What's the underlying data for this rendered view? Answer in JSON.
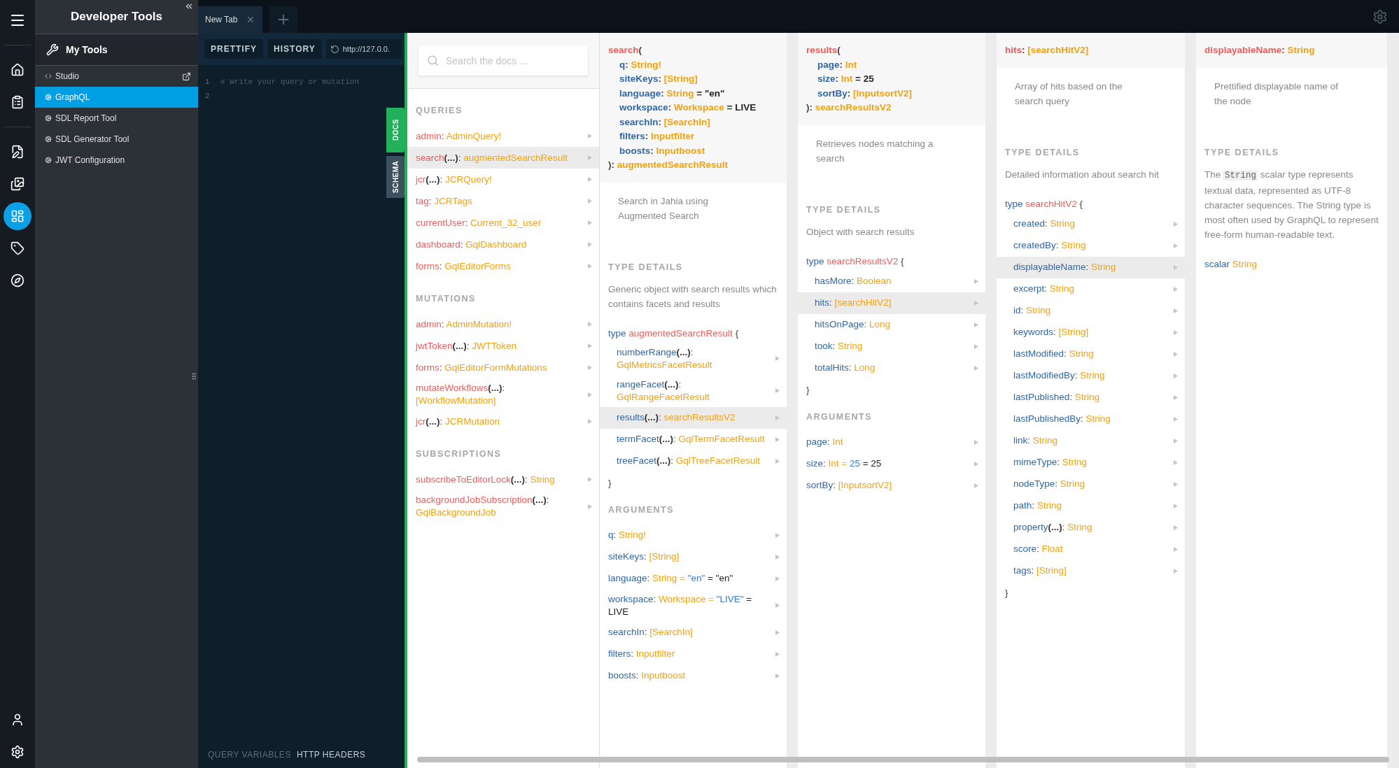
{
  "rail": {
    "top_items": [
      {
        "selected": false
      },
      {
        "selected": false
      },
      {
        "selected": false
      },
      {
        "selected": false
      },
      {
        "selected": true
      },
      {
        "selected": false
      },
      {
        "selected": false
      }
    ],
    "bottom_items": [
      {
        "selected": false
      },
      {
        "selected": false
      }
    ]
  },
  "sidebar": {
    "title": "Developer Tools",
    "section": "My Tools",
    "items": [
      {
        "label": "Studio",
        "selected": false,
        "external": true
      },
      {
        "label": "GraphQL",
        "selected": true,
        "external": false
      },
      {
        "label": "SDL Report Tool",
        "selected": false,
        "external": false
      },
      {
        "label": "SDL Generator Tool",
        "selected": false,
        "external": false
      },
      {
        "label": "JWT Configuration",
        "selected": false,
        "external": false
      }
    ]
  },
  "tabs": [
    {
      "label": "New Tab",
      "selected": true
    }
  ],
  "editor": {
    "buttons": [
      "PRETTIFY",
      "HISTORY"
    ],
    "url": "http://127.0.0.",
    "lines": [
      {
        "number": "1",
        "text": "# Write your query or mutation"
      },
      {
        "number": "2"
      }
    ],
    "panels": [
      {
        "label": "QUERY VARIABLES",
        "selected": false
      },
      {
        "label": "HTTP HEADERS",
        "selected": true
      }
    ],
    "side_tabs": [
      {
        "label": "DOCS",
        "selected": true
      },
      {
        "label": "SCHEMA",
        "selected": false
      }
    ]
  },
  "docs": {
    "search_placeholder": "Search the docs ...",
    "sections": [
      {
        "title": "QUERIES",
        "rows": [
          {
            "parts": [
              {
                "text": "admin",
                "kind": "root"
              },
              {
                "text": ": ",
                "kind": "punct"
              },
              {
                "text": "AdminQuery!",
                "kind": "type"
              }
            ],
            "selected": false
          },
          {
            "parts": [
              {
                "text": "search",
                "kind": "root"
              },
              {
                "text": "(...)",
                "kind": "args"
              },
              {
                "text": ": ",
                "kind": "punct"
              },
              {
                "text": "augmentedSearchResult",
                "kind": "type"
              }
            ],
            "selected": true
          },
          {
            "parts": [
              {
                "text": "jcr",
                "kind": "root"
              },
              {
                "text": "(...)",
                "kind": "args"
              },
              {
                "text": ": ",
                "kind": "punct"
              },
              {
                "text": "JCRQuery!",
                "kind": "type"
              }
            ],
            "selected": false
          },
          {
            "parts": [
              {
                "text": "tag",
                "kind": "root"
              },
              {
                "text": ": ",
                "kind": "punct"
              },
              {
                "text": "JCRTags",
                "kind": "type"
              }
            ],
            "selected": false
          },
          {
            "parts": [
              {
                "text": "currentUser",
                "kind": "root"
              },
              {
                "text": ": ",
                "kind": "punct"
              },
              {
                "text": "Current_32_user",
                "kind": "type"
              }
            ],
            "selected": false
          },
          {
            "parts": [
              {
                "text": "dashboard",
                "kind": "root"
              },
              {
                "text": ": ",
                "kind": "punct"
              },
              {
                "text": "GqlDashboard",
                "kind": "type"
              }
            ],
            "selected": false
          },
          {
            "parts": [
              {
                "text": "forms",
                "kind": "root"
              },
              {
                "text": ": ",
                "kind": "punct"
              },
              {
                "text": "GqlEditorForms",
                "kind": "type"
              }
            ],
            "selected": false
          }
        ]
      },
      {
        "title": "MUTATIONS",
        "rows": [
          {
            "parts": [
              {
                "text": "admin",
                "kind": "root"
              },
              {
                "text": ": ",
                "kind": "punct"
              },
              {
                "text": "AdminMutation!",
                "kind": "type"
              }
            ],
            "selected": false
          },
          {
            "parts": [
              {
                "text": "jwtToken",
                "kind": "root"
              },
              {
                "text": "(...)",
                "kind": "args"
              },
              {
                "text": ": ",
                "kind": "punct"
              },
              {
                "text": "JWTToken",
                "kind": "type"
              }
            ],
            "selected": false
          },
          {
            "parts": [
              {
                "text": "forms",
                "kind": "root"
              },
              {
                "text": ": ",
                "kind": "punct"
              },
              {
                "text": "GqlEditorFormMutations",
                "kind": "type"
              }
            ],
            "selected": false
          },
          {
            "parts": [
              {
                "text": "mutateWorkflows",
                "kind": "root"
              },
              {
                "text": "(...)",
                "kind": "args"
              },
              {
                "text": ": ",
                "kind": "punct"
              },
              {
                "text": "[WorkflowMutation]",
                "kind": "type"
              }
            ],
            "selected": false
          },
          {
            "parts": [
              {
                "text": "jcr",
                "kind": "root"
              },
              {
                "text": "(...)",
                "kind": "args"
              },
              {
                "text": ": ",
                "kind": "punct"
              },
              {
                "text": "JCRMutation",
                "kind": "type"
              }
            ],
            "selected": false
          }
        ]
      },
      {
        "title": "SUBSCRIPTIONS",
        "rows": [
          {
            "parts": [
              {
                "text": "subscribeToEditorLock",
                "kind": "root"
              },
              {
                "text": "(...)",
                "kind": "args"
              },
              {
                "text": ": ",
                "kind": "punct"
              },
              {
                "text": "String",
                "kind": "type"
              }
            ],
            "selected": false
          },
          {
            "parts": [
              {
                "text": "backgroundJobSubscription",
                "kind": "root"
              },
              {
                "text": "(...)",
                "kind": "args"
              },
              {
                "text": ": ",
                "kind": "punct"
              },
              {
                "text": "GqlBackgroundJob",
                "kind": "type"
              }
            ],
            "selected": false
          }
        ]
      }
    ],
    "columns": [
      {
        "header": [
          {
            "indent": false,
            "parts": [
              {
                "text": "search",
                "kind": "root"
              },
              {
                "text": "(",
                "kind": "punct"
              }
            ]
          },
          {
            "indent": true,
            "parts": [
              {
                "text": "q",
                "kind": "field"
              },
              {
                "text": ": ",
                "kind": "punct"
              },
              {
                "text": "String!",
                "kind": "type"
              }
            ]
          },
          {
            "indent": true,
            "parts": [
              {
                "text": "siteKeys",
                "kind": "field"
              },
              {
                "text": ": ",
                "kind": "punct"
              },
              {
                "text": "[String]",
                "kind": "type"
              }
            ]
          },
          {
            "indent": true,
            "parts": [
              {
                "text": "language",
                "kind": "field"
              },
              {
                "text": ": ",
                "kind": "punct"
              },
              {
                "text": "String",
                "kind": "type"
              },
              {
                "text": " = \"en\"",
                "kind": "value"
              }
            ]
          },
          {
            "indent": true,
            "parts": [
              {
                "text": "workspace",
                "kind": "field"
              },
              {
                "text": ": ",
                "kind": "punct"
              },
              {
                "text": "Workspace",
                "kind": "type"
              },
              {
                "text": " = LIVE",
                "kind": "value"
              }
            ]
          },
          {
            "indent": true,
            "parts": [
              {
                "text": "searchIn",
                "kind": "field"
              },
              {
                "text": ": ",
                "kind": "punct"
              },
              {
                "text": "[SearchIn]",
                "kind": "type"
              }
            ]
          },
          {
            "indent": true,
            "parts": [
              {
                "text": "filters",
                "kind": "field"
              },
              {
                "text": ": ",
                "kind": "punct"
              },
              {
                "text": "Inputfilter",
                "kind": "type"
              }
            ]
          },
          {
            "indent": true,
            "parts": [
              {
                "text": "boosts",
                "kind": "field"
              },
              {
                "text": ": ",
                "kind": "punct"
              },
              {
                "text": "Inputboost",
                "kind": "type"
              }
            ]
          },
          {
            "indent": false,
            "parts": [
              {
                "text": "): ",
                "kind": "punct"
              },
              {
                "text": "augmentedSearchResult",
                "kind": "type"
              }
            ]
          }
        ],
        "description": "Search in Jahia using Augmented Search",
        "type_details": {
          "title": "TYPE DETAILS",
          "text": [
            {
              "text": "Generic object with search results which contains facets and results",
              "kind": "text"
            }
          ],
          "declaration": [
            {
              "text": "type ",
              "kind": "keyword"
            },
            {
              "text": "augmentedSearchResult",
              "kind": "root"
            },
            {
              "text": " {",
              "kind": "punct"
            }
          ],
          "fields": [
            {
              "parts": [
                {
                  "text": "numberRange",
                  "kind": "field"
                },
                {
                  "text": "(...)",
                  "kind": "args"
                },
                {
                  "text": ": ",
                  "kind": "punct"
                },
                {
                  "text": "GqlMetricsFacetResult",
                  "kind": "type"
                }
              ],
              "selected": false
            },
            {
              "parts": [
                {
                  "text": "rangeFacet",
                  "kind": "field"
                },
                {
                  "text": "(...)",
                  "kind": "args"
                },
                {
                  "text": ": ",
                  "kind": "punct"
                },
                {
                  "text": "GqlRangeFacetResult",
                  "kind": "type"
                }
              ],
              "selected": false
            },
            {
              "parts": [
                {
                  "text": "results",
                  "kind": "field"
                },
                {
                  "text": "(...)",
                  "kind": "args"
                },
                {
                  "text": ": ",
                  "kind": "punct"
                },
                {
                  "text": "searchResultsV2",
                  "kind": "type"
                }
              ],
              "selected": true
            },
            {
              "parts": [
                {
                  "text": "termFacet",
                  "kind": "field"
                },
                {
                  "text": "(...)",
                  "kind": "args"
                },
                {
                  "text": ": ",
                  "kind": "punct"
                },
                {
                  "text": "GqlTermFacetResult",
                  "kind": "type"
                }
              ],
              "selected": false
            },
            {
              "parts": [
                {
                  "text": "treeFacet",
                  "kind": "field"
                },
                {
                  "text": "(...)",
                  "kind": "args"
                },
                {
                  "text": ": ",
                  "kind": "punct"
                },
                {
                  "text": "GqlTreeFacetResult",
                  "kind": "type"
                }
              ],
              "selected": false
            }
          ],
          "closing": "}"
        },
        "arguments": {
          "title": "ARGUMENTS",
          "rows": [
            {
              "parts": [
                {
                  "text": "q",
                  "kind": "field"
                },
                {
                  "text": ": ",
                  "kind": "punct"
                },
                {
                  "text": "String!",
                  "kind": "type"
                }
              ],
              "selected": false
            },
            {
              "parts": [
                {
                  "text": "siteKeys",
                  "kind": "field"
                },
                {
                  "text": ": ",
                  "kind": "punct"
                },
                {
                  "text": "[String]",
                  "kind": "type"
                }
              ],
              "selected": false
            },
            {
              "parts": [
                {
                  "text": "language",
                  "kind": "field"
                },
                {
                  "text": ": ",
                  "kind": "punct"
                },
                {
                  "text": "String",
                  "kind": "type"
                },
                {
                  "text": " = ",
                  "kind": "eq"
                },
                {
                  "text": "\"en\"",
                  "kind": "def"
                },
                {
                  "text": " = \"en\"",
                  "kind": "value"
                }
              ],
              "selected": false
            },
            {
              "parts": [
                {
                  "text": "workspace",
                  "kind": "field"
                },
                {
                  "text": ": ",
                  "kind": "punct"
                },
                {
                  "text": "Workspace",
                  "kind": "type"
                },
                {
                  "text": " = ",
                  "kind": "eq"
                },
                {
                  "text": "\"LIVE\"",
                  "kind": "def"
                },
                {
                  "text": " = LIVE",
                  "kind": "value"
                }
              ],
              "selected": false
            },
            {
              "parts": [
                {
                  "text": "searchIn",
                  "kind": "field"
                },
                {
                  "text": ": ",
                  "kind": "punct"
                },
                {
                  "text": "[SearchIn]",
                  "kind": "type"
                }
              ],
              "selected": false
            },
            {
              "parts": [
                {
                  "text": "filters",
                  "kind": "field"
                },
                {
                  "text": ": ",
                  "kind": "punct"
                },
                {
                  "text": "Inputfilter",
                  "kind": "type"
                }
              ],
              "selected": false
            },
            {
              "parts": [
                {
                  "text": "boosts",
                  "kind": "field"
                },
                {
                  "text": ": ",
                  "kind": "punct"
                },
                {
                  "text": "Inputboost",
                  "kind": "type"
                }
              ],
              "selected": false
            }
          ]
        }
      },
      {
        "header": [
          {
            "indent": false,
            "parts": [
              {
                "text": "results",
                "kind": "root"
              },
              {
                "text": "(",
                "kind": "punct"
              }
            ]
          },
          {
            "indent": true,
            "parts": [
              {
                "text": "page",
                "kind": "field"
              },
              {
                "text": ": ",
                "kind": "punct"
              },
              {
                "text": "Int",
                "kind": "type"
              }
            ]
          },
          {
            "indent": true,
            "parts": [
              {
                "text": "size",
                "kind": "field"
              },
              {
                "text": ": ",
                "kind": "punct"
              },
              {
                "text": "Int",
                "kind": "type"
              },
              {
                "text": " = 25",
                "kind": "value"
              }
            ]
          },
          {
            "indent": true,
            "parts": [
              {
                "text": "sortBy",
                "kind": "field"
              },
              {
                "text": ": ",
                "kind": "punct"
              },
              {
                "text": "[InputsortV2]",
                "kind": "type"
              }
            ]
          },
          {
            "indent": false,
            "parts": [
              {
                "text": "): ",
                "kind": "punct"
              },
              {
                "text": "searchResultsV2",
                "kind": "type"
              }
            ]
          }
        ],
        "description": "Retrieves nodes matching a search",
        "type_details": {
          "title": "TYPE DETAILS",
          "text": [
            {
              "text": "Object with search results",
              "kind": "text"
            }
          ],
          "declaration": [
            {
              "text": "type ",
              "kind": "keyword"
            },
            {
              "text": "searchResultsV2",
              "kind": "root"
            },
            {
              "text": " {",
              "kind": "punct"
            }
          ],
          "fields": [
            {
              "parts": [
                {
                  "text": "hasMore",
                  "kind": "field"
                },
                {
                  "text": ": ",
                  "kind": "punct"
                },
                {
                  "text": "Boolean",
                  "kind": "type"
                }
              ],
              "selected": false
            },
            {
              "parts": [
                {
                  "text": "hits",
                  "kind": "field"
                },
                {
                  "text": ": ",
                  "kind": "punct"
                },
                {
                  "text": "[searchHitV2]",
                  "kind": "type"
                }
              ],
              "selected": true
            },
            {
              "parts": [
                {
                  "text": "hitsOnPage",
                  "kind": "field"
                },
                {
                  "text": ": ",
                  "kind": "punct"
                },
                {
                  "text": "Long",
                  "kind": "type"
                }
              ],
              "selected": false
            },
            {
              "parts": [
                {
                  "text": "took",
                  "kind": "field"
                },
                {
                  "text": ": ",
                  "kind": "punct"
                },
                {
                  "text": "String",
                  "kind": "type"
                }
              ],
              "selected": false
            },
            {
              "parts": [
                {
                  "text": "totalHits",
                  "kind": "field"
                },
                {
                  "text": ": ",
                  "kind": "punct"
                },
                {
                  "text": "Long",
                  "kind": "type"
                }
              ],
              "selected": false
            }
          ],
          "closing": "}"
        },
        "arguments": {
          "title": "ARGUMENTS",
          "rows": [
            {
              "parts": [
                {
                  "text": "page",
                  "kind": "field"
                },
                {
                  "text": ": ",
                  "kind": "punct"
                },
                {
                  "text": "Int",
                  "kind": "type"
                }
              ],
              "selected": false
            },
            {
              "parts": [
                {
                  "text": "size",
                  "kind": "field"
                },
                {
                  "text": ": ",
                  "kind": "punct"
                },
                {
                  "text": "Int",
                  "kind": "type"
                },
                {
                  "text": " = ",
                  "kind": "eq"
                },
                {
                  "text": "25",
                  "kind": "def"
                },
                {
                  "text": " = 25",
                  "kind": "value"
                }
              ],
              "selected": false
            },
            {
              "parts": [
                {
                  "text": "sortBy",
                  "kind": "field"
                },
                {
                  "text": ": ",
                  "kind": "punct"
                },
                {
                  "text": "[InputsortV2]",
                  "kind": "type"
                }
              ],
              "selected": false
            }
          ]
        }
      },
      {
        "header": [
          {
            "indent": false,
            "parts": [
              {
                "text": "hits",
                "kind": "root"
              },
              {
                "text": ": ",
                "kind": "punct"
              },
              {
                "text": "[searchHitV2]",
                "kind": "type"
              }
            ]
          }
        ],
        "description": "Array of hits based on the search query",
        "type_details": {
          "title": "TYPE DETAILS",
          "text": [
            {
              "text": "Detailed information about search hit",
              "kind": "text"
            }
          ],
          "declaration": [
            {
              "text": "type ",
              "kind": "keyword"
            },
            {
              "text": "searchHitV2",
              "kind": "root"
            },
            {
              "text": " {",
              "kind": "punct"
            }
          ],
          "fields": [
            {
              "parts": [
                {
                  "text": "created",
                  "kind": "field"
                },
                {
                  "text": ": ",
                  "kind": "punct"
                },
                {
                  "text": "String",
                  "kind": "type"
                }
              ],
              "selected": false
            },
            {
              "parts": [
                {
                  "text": "createdBy",
                  "kind": "field"
                },
                {
                  "text": ": ",
                  "kind": "punct"
                },
                {
                  "text": "String",
                  "kind": "type"
                }
              ],
              "selected": false
            },
            {
              "parts": [
                {
                  "text": "displayableName",
                  "kind": "field"
                },
                {
                  "text": ": ",
                  "kind": "punct"
                },
                {
                  "text": "String",
                  "kind": "type"
                }
              ],
              "selected": true
            },
            {
              "parts": [
                {
                  "text": "excerpt",
                  "kind": "field"
                },
                {
                  "text": ": ",
                  "kind": "punct"
                },
                {
                  "text": "String",
                  "kind": "type"
                }
              ],
              "selected": false
            },
            {
              "parts": [
                {
                  "text": "id",
                  "kind": "field"
                },
                {
                  "text": ": ",
                  "kind": "punct"
                },
                {
                  "text": "String",
                  "kind": "type"
                }
              ],
              "selected": false
            },
            {
              "parts": [
                {
                  "text": "keywords",
                  "kind": "field"
                },
                {
                  "text": ": ",
                  "kind": "punct"
                },
                {
                  "text": "[String]",
                  "kind": "type"
                }
              ],
              "selected": false
            },
            {
              "parts": [
                {
                  "text": "lastModified",
                  "kind": "field"
                },
                {
                  "text": ": ",
                  "kind": "punct"
                },
                {
                  "text": "String",
                  "kind": "type"
                }
              ],
              "selected": false
            },
            {
              "parts": [
                {
                  "text": "lastModifiedBy",
                  "kind": "field"
                },
                {
                  "text": ": ",
                  "kind": "punct"
                },
                {
                  "text": "String",
                  "kind": "type"
                }
              ],
              "selected": false
            },
            {
              "parts": [
                {
                  "text": "lastPublished",
                  "kind": "field"
                },
                {
                  "text": ": ",
                  "kind": "punct"
                },
                {
                  "text": "String",
                  "kind": "type"
                }
              ],
              "selected": false
            },
            {
              "parts": [
                {
                  "text": "lastPublishedBy",
                  "kind": "field"
                },
                {
                  "text": ": ",
                  "kind": "punct"
                },
                {
                  "text": "String",
                  "kind": "type"
                }
              ],
              "selected": false
            },
            {
              "parts": [
                {
                  "text": "link",
                  "kind": "field"
                },
                {
                  "text": ": ",
                  "kind": "punct"
                },
                {
                  "text": "String",
                  "kind": "type"
                }
              ],
              "selected": false
            },
            {
              "parts": [
                {
                  "text": "mimeType",
                  "kind": "field"
                },
                {
                  "text": ": ",
                  "kind": "punct"
                },
                {
                  "text": "String",
                  "kind": "type"
                }
              ],
              "selected": false
            },
            {
              "parts": [
                {
                  "text": "nodeType",
                  "kind": "field"
                },
                {
                  "text": ": ",
                  "kind": "punct"
                },
                {
                  "text": "String",
                  "kind": "type"
                }
              ],
              "selected": false
            },
            {
              "parts": [
                {
                  "text": "path",
                  "kind": "field"
                },
                {
                  "text": ": ",
                  "kind": "punct"
                },
                {
                  "text": "String",
                  "kind": "type"
                }
              ],
              "selected": false
            },
            {
              "parts": [
                {
                  "text": "property",
                  "kind": "field"
                },
                {
                  "text": "(...)",
                  "kind": "args"
                },
                {
                  "text": ": ",
                  "kind": "punct"
                },
                {
                  "text": "String",
                  "kind": "type"
                }
              ],
              "selected": false
            },
            {
              "parts": [
                {
                  "text": "score",
                  "kind": "field"
                },
                {
                  "text": ": ",
                  "kind": "punct"
                },
                {
                  "text": "Float",
                  "kind": "type"
                }
              ],
              "selected": false
            },
            {
              "parts": [
                {
                  "text": "tags",
                  "kind": "field"
                },
                {
                  "text": ": ",
                  "kind": "punct"
                },
                {
                  "text": "[String]",
                  "kind": "type"
                }
              ],
              "selected": false
            }
          ],
          "closing": "}"
        }
      },
      {
        "header": [
          {
            "indent": false,
            "parts": [
              {
                "text": "displayableName",
                "kind": "root"
              },
              {
                "text": ": ",
                "kind": "punct"
              },
              {
                "text": "String",
                "kind": "type"
              }
            ]
          }
        ],
        "description": "Prettified displayable name of the node",
        "type_details": {
          "title": "TYPE DETAILS",
          "text": [
            {
              "text": "The ",
              "kind": "text"
            },
            {
              "text": "String",
              "kind": "code"
            },
            {
              "text": " scalar type represents textual data, represented as UTF-8 character sequences. The String type is most often used by GraphQL to represent free-form human-readable text.",
              "kind": "text"
            }
          ],
          "declaration": [
            {
              "text": "scalar ",
              "kind": "keyword"
            },
            {
              "text": "String",
              "kind": "type"
            }
          ]
        }
      }
    ]
  }
}
